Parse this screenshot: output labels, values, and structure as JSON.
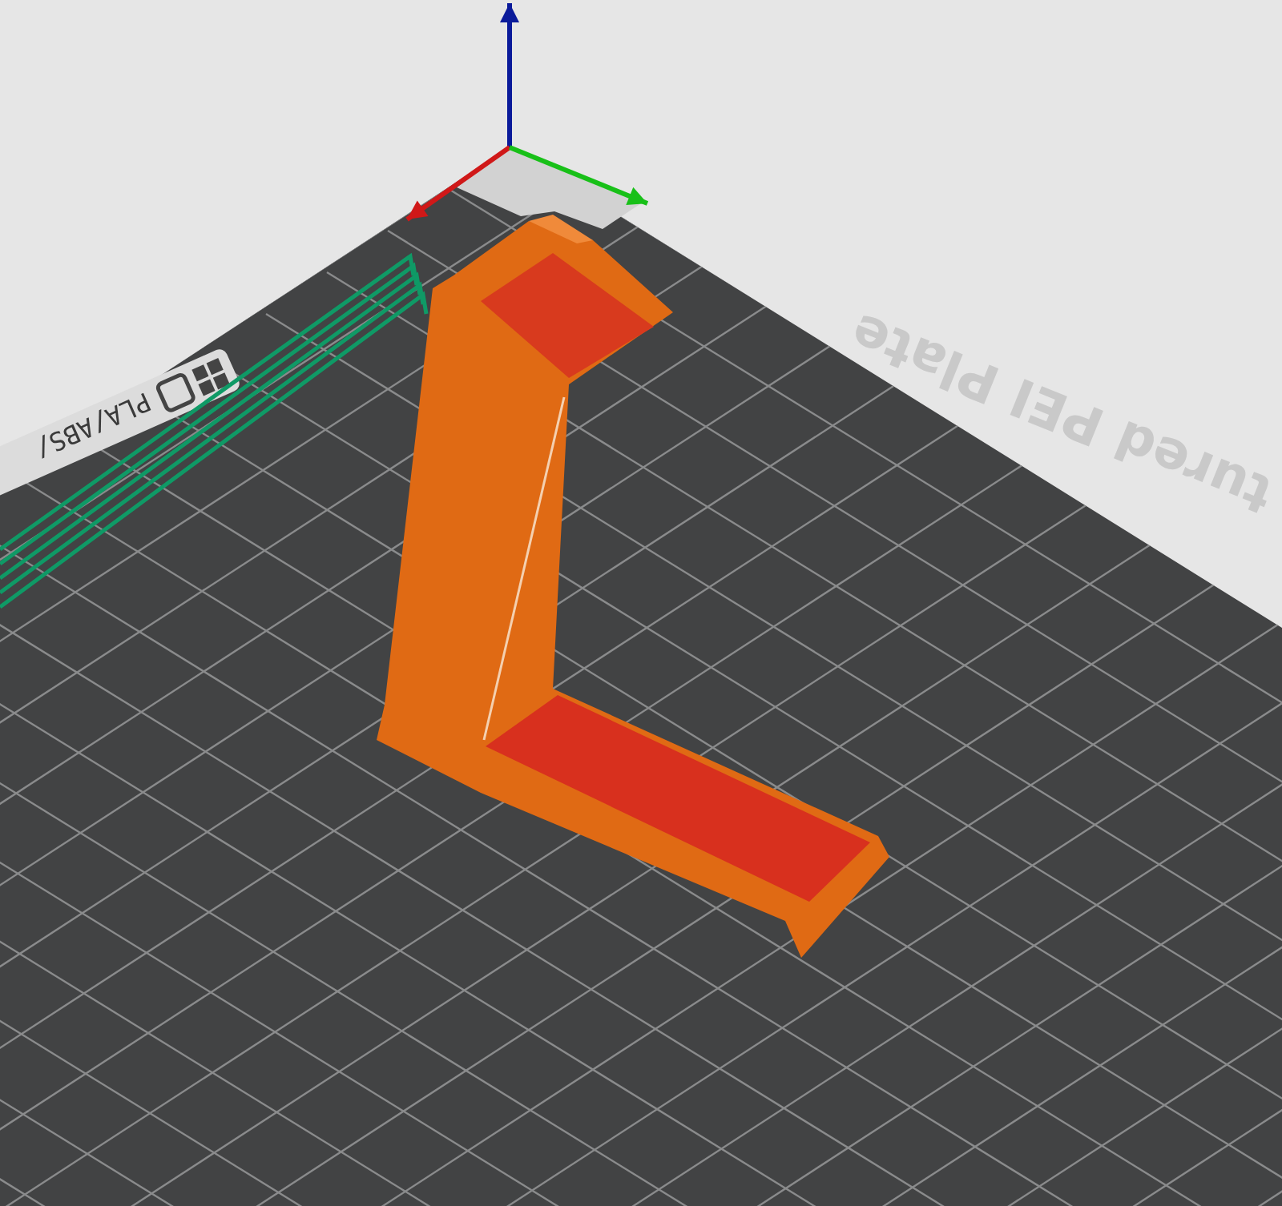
{
  "viewport": {
    "bed_texture_text": "tured PEI Plate",
    "bed_label": "PLA/ABS/"
  }
}
